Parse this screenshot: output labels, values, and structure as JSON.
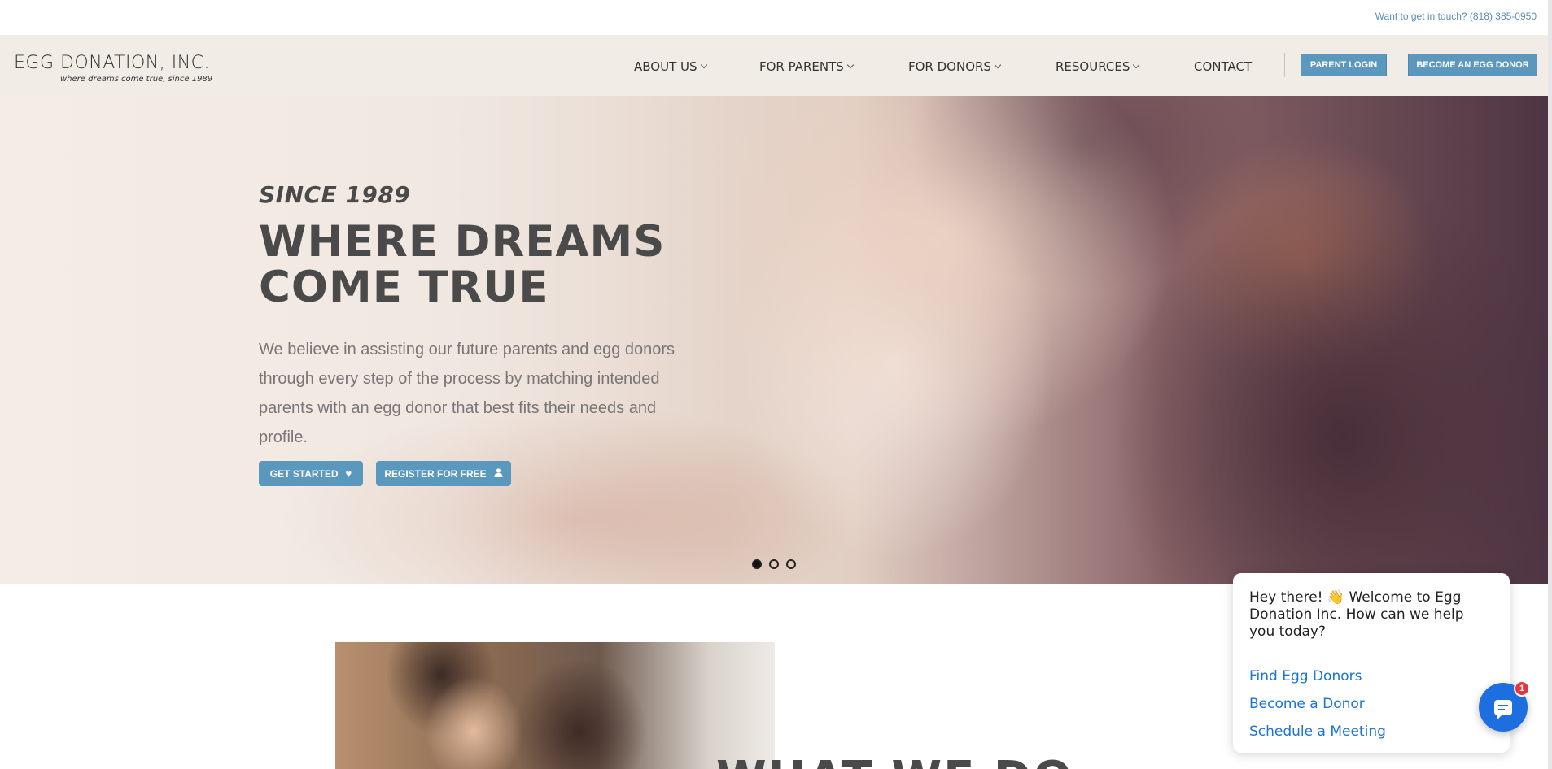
{
  "topbar": {
    "contact_text": "Want to get in touch? (818) 385-0950"
  },
  "header": {
    "logo_main": "EGG DONATION, INC.",
    "logo_tagline": "where dreams come true, since 1989",
    "nav": [
      {
        "label": "ABOUT US"
      },
      {
        "label": "FOR PARENTS"
      },
      {
        "label": "FOR DONORS"
      },
      {
        "label": "RESOURCES"
      },
      {
        "label": "CONTACT"
      }
    ],
    "parent_login": "PARENT LOGIN",
    "become_donor": "BECOME AN EGG DONOR"
  },
  "hero": {
    "eyebrow": "SINCE 1989",
    "title_line1": "WHERE DREAMS",
    "title_line2": "COME TRUE",
    "body": "We believe in assisting our future parents and egg donors through every step of the process by matching intended parents with an egg donor that best fits their needs and profile.",
    "get_started": "GET STARTED",
    "register": "REGISTER FOR FREE",
    "slides_total": 3,
    "active_slide": 1
  },
  "section": {
    "title": "WHAT WE DO"
  },
  "chat": {
    "greeting": "Hey there! 👋 Welcome to Egg Donation Inc. How can we help you today?",
    "options": [
      "Find Egg Donors",
      "Become a Donor",
      "Schedule a Meeting"
    ],
    "badge_count": "1"
  },
  "colors": {
    "accent": "#5c97bd",
    "nav_bg": "#f1ece6",
    "chat_link": "#1b74d6",
    "chat_fab": "#1d6fe0",
    "badge": "#e8343d"
  },
  "icons": {
    "get_started": "heart-icon",
    "register": "user-icon",
    "chat_fab": "chat-bubble-icon",
    "nav_dropdown": "chevron-down-icon"
  }
}
